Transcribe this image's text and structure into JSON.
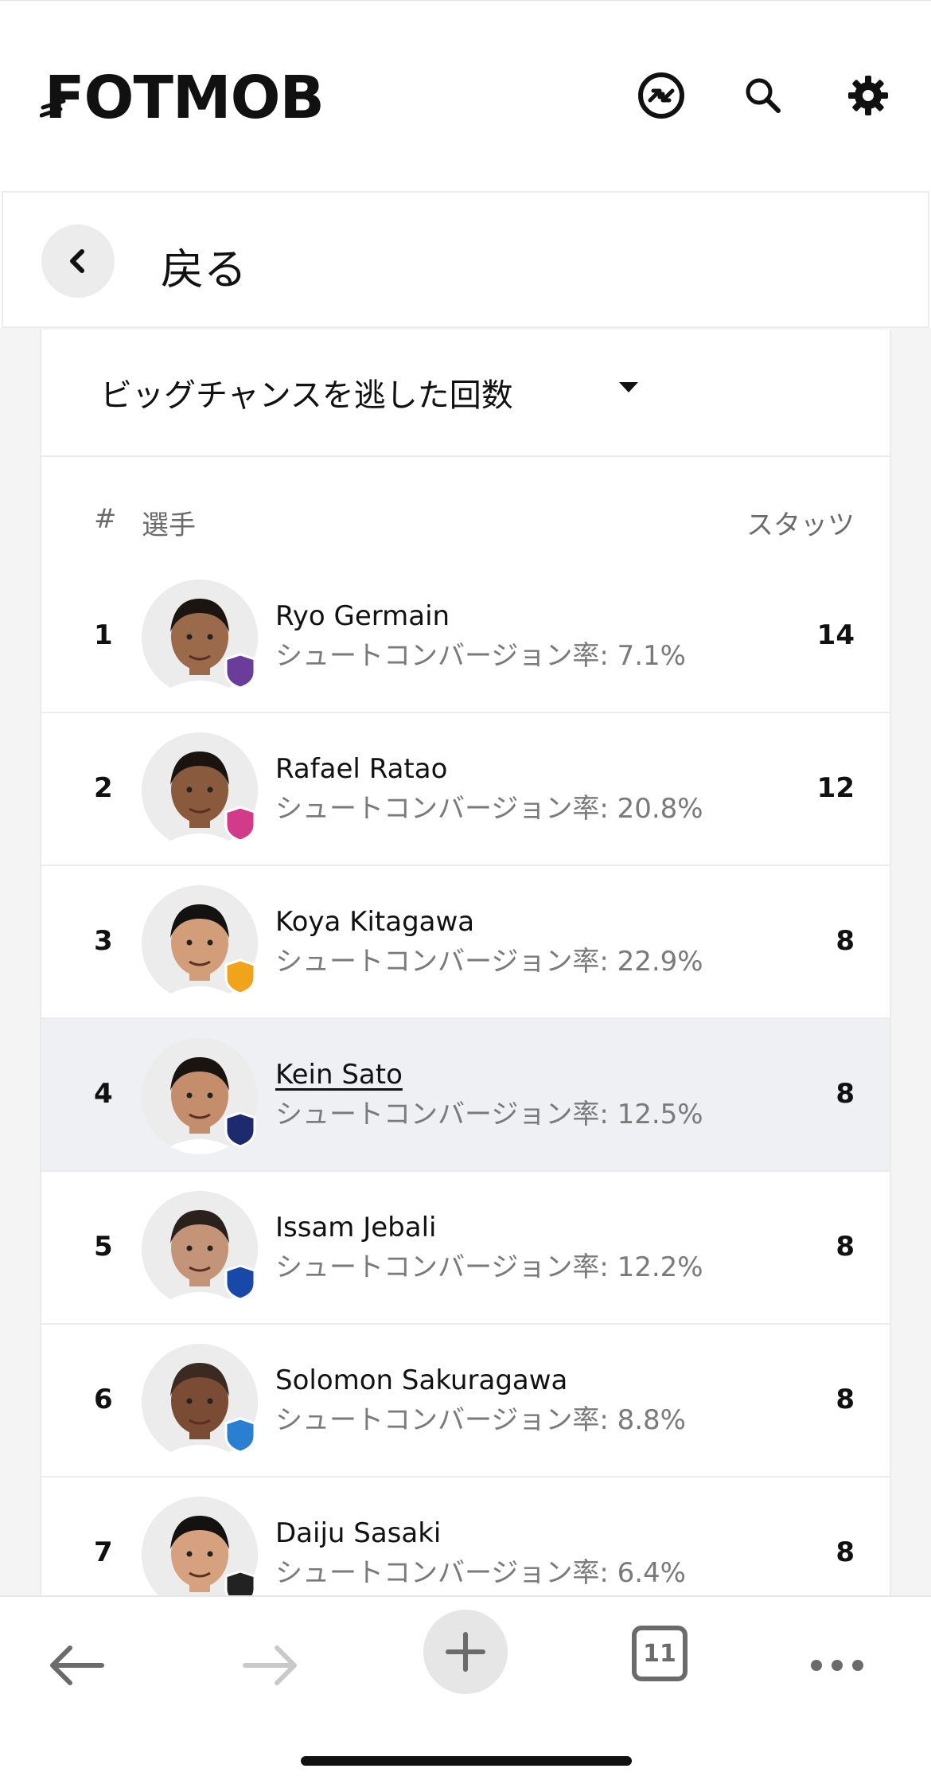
{
  "header": {
    "logo_text": "FOTMOB",
    "icons": [
      "switch-icon",
      "search-icon",
      "gear-icon"
    ]
  },
  "back": {
    "label": "戻る"
  },
  "selector": {
    "label": "ビッグチャンスを逃した回数"
  },
  "table": {
    "headers": {
      "rank": "#",
      "player": "選手",
      "stat": "スタッツ"
    },
    "rows": [
      {
        "rank": "1",
        "name": "Ryo Germain",
        "detail": "シュートコンバージョン率: 7.1%",
        "stat": "14",
        "badge_color": "#6a3d9a",
        "skin": "#9a6a4a",
        "hair": "#1b1511"
      },
      {
        "rank": "2",
        "name": "Rafael Ratao",
        "detail": "シュートコンバージョン率: 20.8%",
        "stat": "12",
        "badge_color": "#d23a8a",
        "skin": "#8a5a3d",
        "hair": "#1a1411"
      },
      {
        "rank": "3",
        "name": "Koya Kitagawa",
        "detail": "シュートコンバージョン率: 22.9%",
        "stat": "8",
        "badge_color": "#f2a31c",
        "skin": "#d29e7a",
        "hair": "#141111"
      },
      {
        "rank": "4",
        "name": "Kein Sato",
        "detail": "シュートコンバージョン率: 12.5%",
        "stat": "8",
        "badge_color": "#1e2a6e",
        "skin": "#c48e6c",
        "hair": "#1a1411"
      },
      {
        "rank": "5",
        "name": "Issam Jebali",
        "detail": "シュートコンバージョン率: 12.2%",
        "stat": "8",
        "badge_color": "#1848a8",
        "skin": "#c49478",
        "hair": "#2b211c"
      },
      {
        "rank": "6",
        "name": "Solomon Sakuragawa",
        "detail": "シュートコンバージョン率: 8.8%",
        "stat": "8",
        "badge_color": "#2a7fd0",
        "skin": "#7a4c33",
        "hair": "#3b2a22"
      },
      {
        "rank": "7",
        "name": "Daiju Sasaki",
        "detail": "シュートコンバージョン率: 6.4%",
        "stat": "8",
        "badge_color": "#222222",
        "skin": "#d6a17e",
        "hair": "#141111"
      }
    ]
  },
  "bottom_nav": {
    "tab_count": "11"
  },
  "colors": {
    "highlight_row": "#eef0f3",
    "muted_text": "#7a7a7a"
  }
}
